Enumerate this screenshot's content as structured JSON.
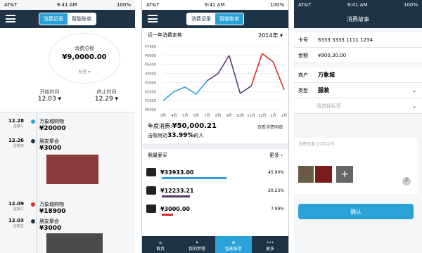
{
  "status": {
    "carrier": "AT&T",
    "time": "9:41 AM",
    "battery": "100%"
  },
  "left": {
    "tabs": [
      "消费记录",
      "智能账单"
    ],
    "total_label": "消费总额",
    "total_value": "¥9,0000.00",
    "tag_label": "标签",
    "start_label": "开始时间",
    "start_value": "12.03",
    "end_label": "终止时间",
    "end_value": "12.29",
    "entries": [
      {
        "date": "12.28",
        "weekday": "星期三",
        "title": "万象城购物",
        "amount": "¥20000",
        "dot": "#2aa2d8"
      },
      {
        "date": "12.26",
        "weekday": "星期天",
        "title": "朋友聚会",
        "amount": "¥3000",
        "dot": "#1f3347"
      },
      {
        "date": "12.09",
        "weekday": "星期三",
        "title": "万象城购物",
        "amount": "¥18900",
        "dot": "#d62c2c"
      },
      {
        "date": "12.03",
        "weekday": "星期五",
        "title": "朋友聚会",
        "amount": "¥3000",
        "dot": "#1f3347"
      }
    ]
  },
  "center": {
    "tabs": [
      "消费记录",
      "智能账单"
    ],
    "trend_title": "近一年消费走势",
    "year": "2014年",
    "chart_data": {
      "type": "line",
      "categories": [
        "3月",
        "4月",
        "5月",
        "6月",
        "7月",
        "8月",
        "9月",
        "10月",
        "11月",
        "12月",
        "1月",
        "2月"
      ],
      "series": [
        {
          "values": [
            1000,
            2000,
            2500,
            1700,
            3200,
            4000,
            6000,
            1800,
            2600,
            6200,
            5300,
            2200
          ]
        }
      ],
      "ylim": [
        0,
        7000
      ],
      "yticks": [
        "¥0000",
        "¥1000",
        "¥2000",
        "¥3000",
        "¥4000",
        "¥5000",
        "¥6000",
        "¥7000"
      ]
    },
    "year_total_label": "年度消费:",
    "year_total_value": "¥50,000.21",
    "detail_link": "查看消费明细",
    "beat_text_prefix": "击败附近",
    "beat_percent": "33.99%",
    "beat_text_suffix": "的人",
    "fav_title": "我最爱买",
    "more": "更多",
    "favorites": [
      {
        "amount": "¥33933.00",
        "percent": "45.90%",
        "fill": 0.459,
        "color": "#2aa2d8"
      },
      {
        "amount": "¥12233.21",
        "percent": "20.23%",
        "fill": 0.2023,
        "color": "#5a3a6e"
      },
      {
        "amount": "¥3000.00",
        "percent": "7.99%",
        "fill": 0.0799,
        "color": "#d62c2c"
      }
    ],
    "tabbar": [
      "首页",
      "我的梦想",
      "智能账单",
      "更多"
    ]
  },
  "right": {
    "title": "消费故事",
    "card_label": "卡号",
    "card_number": "6333 3333 1111 1234",
    "amount_label": "金额",
    "amount_value": "¥900,30.00",
    "merchant_label": "商户",
    "merchant_value": "万象城",
    "type_label": "类型",
    "type_value": "服装",
    "tag_placeholder": "请选择标签",
    "story_placeholder": "消费故事 15字以内",
    "add_photo": "添加照片",
    "confirm": "确认"
  }
}
